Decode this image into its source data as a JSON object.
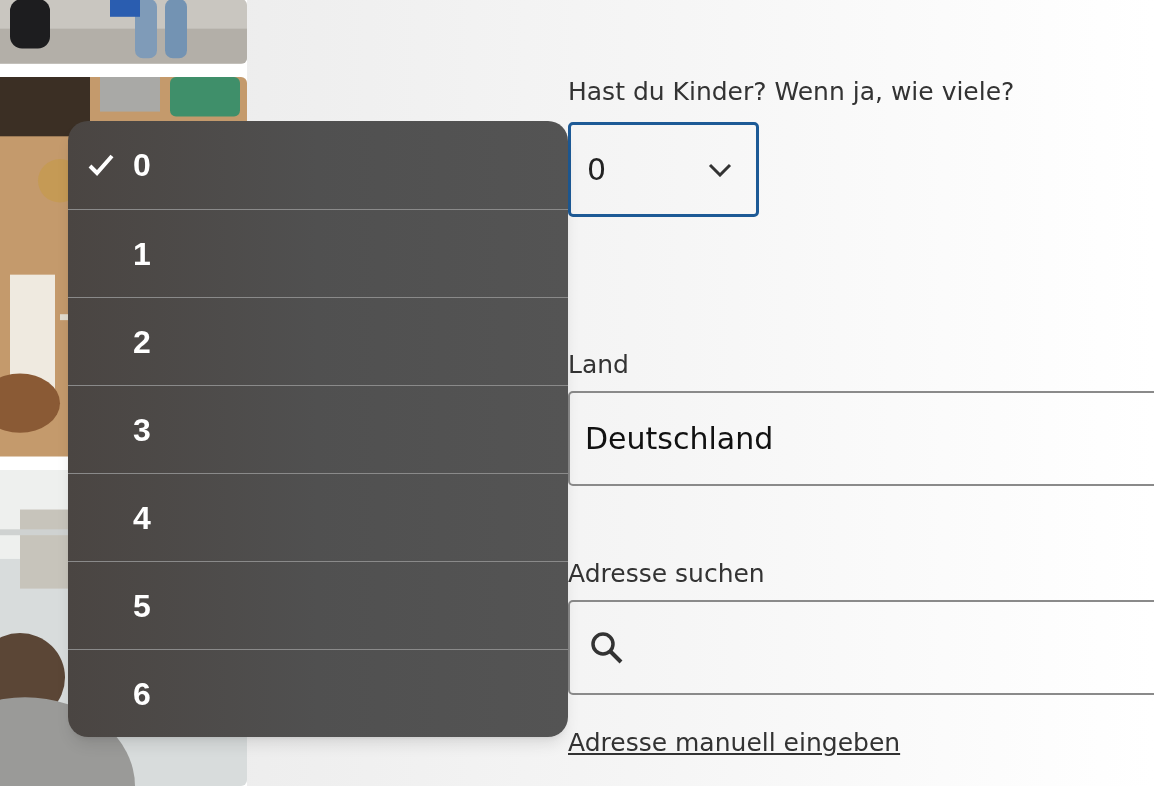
{
  "children_question": {
    "label": "Hast du Kinder? Wenn ja, wie viele?",
    "value": "0",
    "expanded": true,
    "options": [
      {
        "label": "0",
        "selected": true
      },
      {
        "label": "1",
        "selected": false
      },
      {
        "label": "2",
        "selected": false
      },
      {
        "label": "3",
        "selected": false
      },
      {
        "label": "4",
        "selected": false
      },
      {
        "label": "5",
        "selected": false
      },
      {
        "label": "6",
        "selected": false
      }
    ]
  },
  "country": {
    "label": "Land",
    "value": "Deutschland"
  },
  "address": {
    "label": "Adresse suchen"
  },
  "manual_link": "Adresse manuell eingeben"
}
